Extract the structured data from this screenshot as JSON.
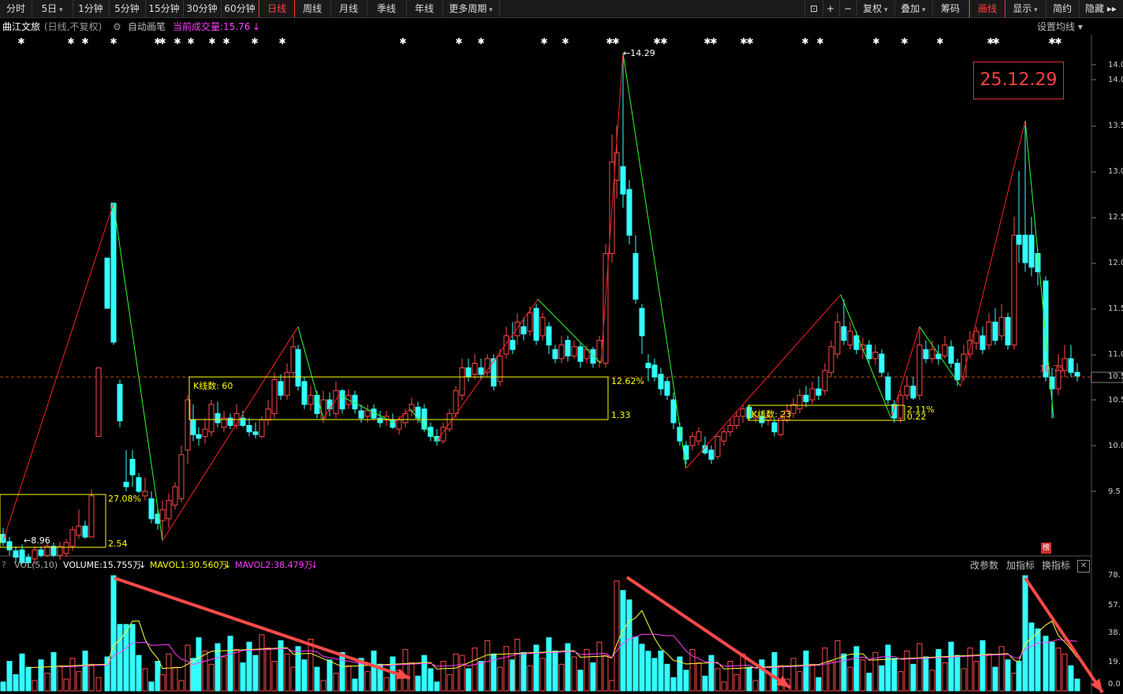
{
  "toolbar": {
    "items": [
      "分时",
      "5日",
      "1分钟",
      "5分钟",
      "15分钟",
      "30分钟",
      "60分钟",
      "日线",
      "周线",
      "月线",
      "季线",
      "年线",
      "更多周期"
    ],
    "right_items": [
      "复权",
      "叠加",
      "筹码",
      "画线",
      "显示",
      "简约",
      "隐藏"
    ],
    "active": "日线"
  },
  "info": {
    "stock_name": "曲江文旅",
    "mode": "(日线,不复权)",
    "draw_label": "自动画笔",
    "volume_label": "当前成交量:15.76",
    "ma_setting": "设置均线"
  },
  "price_box": "25.12.29",
  "price_labels": {
    "high": "←14.29",
    "low": "←8.96",
    "current": "10.75"
  },
  "boxes": [
    {
      "pct": "27.08%",
      "diff": "2.54"
    },
    {
      "kcount": "K线数: 60",
      "pct": "12.62%",
      "diff": "1.33"
    },
    {
      "kcount": "K线数: 23",
      "pct": "2.11%",
      "diff": "0.22"
    }
  ],
  "y_axis": [
    "14.0",
    "14.0",
    "13.5",
    "13.0",
    "12.5",
    "12.0",
    "11.5",
    "11.0",
    "10.5",
    "10.5",
    "10.0",
    "9.5"
  ],
  "vol_axis": [
    "78.",
    "57.",
    "38.",
    "19.",
    "0.0"
  ],
  "volume_bar": {
    "indicator": "VOL(5,10)",
    "volume": "VOLUME:15.755万",
    "mavol1": "MAVOL1:30.560万",
    "mavol2": "MAVOL2:38.479万",
    "btn_params": "改参数",
    "btn_add": "加指标",
    "btn_switch": "换指标"
  },
  "colors": {
    "up": "#ff4a4a",
    "down": "#33ffff",
    "accent": "#ff3030",
    "yellow": "#ffff00"
  },
  "badge": "榜"
}
